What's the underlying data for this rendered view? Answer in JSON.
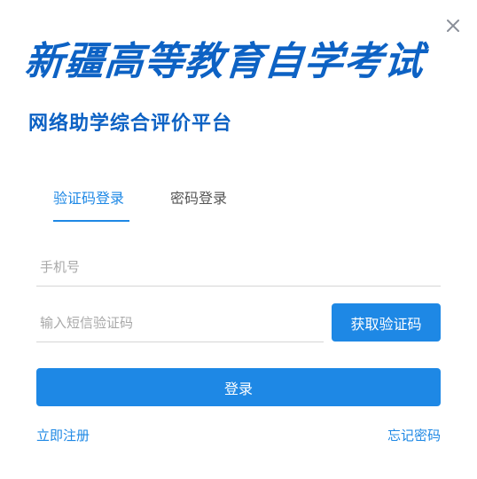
{
  "brand": {
    "title": "新疆高等教育自学考试",
    "subtitle": "网络助学综合评价平台"
  },
  "tabs": [
    {
      "label": "验证码登录",
      "active": true
    },
    {
      "label": "密码登录",
      "active": false
    }
  ],
  "form": {
    "phone": {
      "placeholder": "手机号",
      "value": ""
    },
    "code": {
      "placeholder": "输入短信验证码",
      "value": ""
    },
    "get_code_label": "获取验证码",
    "login_label": "登录"
  },
  "links": {
    "register": "立即注册",
    "forgot": "忘记密码"
  },
  "icons": {
    "close": "close-icon"
  },
  "colors": {
    "accent": "#1e88e5",
    "brand": "#0d62c4",
    "inactive_tab": "#555555",
    "placeholder": "#a8a8a8",
    "divider": "#d6d6d6"
  }
}
